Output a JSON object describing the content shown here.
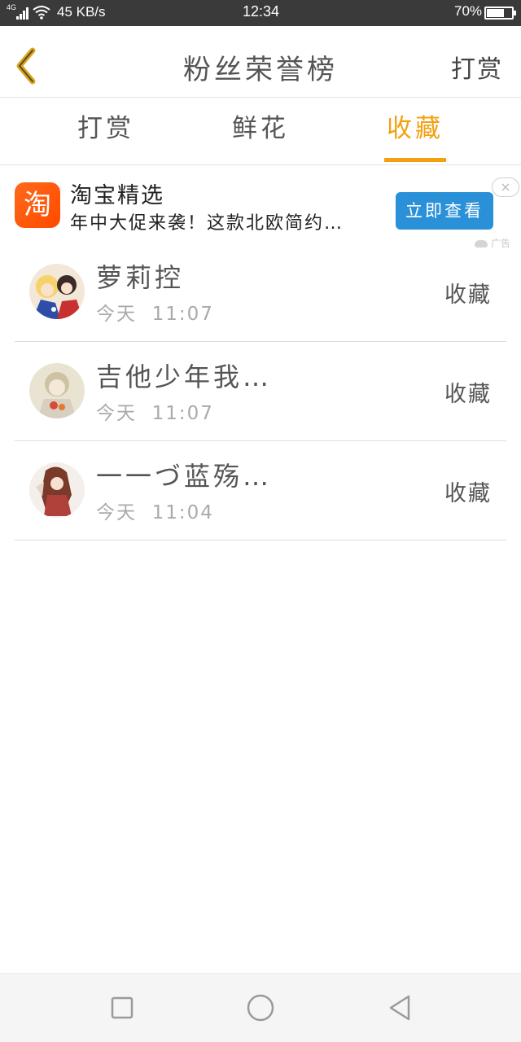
{
  "status_bar": {
    "network": "4G",
    "speed": "45 KB/s",
    "time": "12:34",
    "battery_percent": "70%",
    "battery_level": 0.7
  },
  "header": {
    "title": "粉丝荣誉榜",
    "right_action": "打赏"
  },
  "tabs": [
    {
      "label": "打赏",
      "active": false
    },
    {
      "label": "鲜花",
      "active": false
    },
    {
      "label": "收藏",
      "active": true
    }
  ],
  "ad": {
    "logo_char": "淘",
    "title": "淘宝精选",
    "description": "年中大促来袭！这款北欧简约…",
    "button_label": "立即查看",
    "close_glyph": "×",
    "tag": "广告"
  },
  "fans": [
    {
      "name": "萝莉控",
      "date": "今天",
      "time": "11:07",
      "action": "收藏"
    },
    {
      "name": "吉他少年我…",
      "date": "今天",
      "time": "11:07",
      "action": "收藏"
    },
    {
      "name": "一一づ蓝殇…",
      "date": "今天",
      "time": "11:04",
      "action": "收藏"
    }
  ],
  "colors": {
    "accent": "#f3a010",
    "ad_button": "#2a90d8",
    "ad_logo": "#ff5a00",
    "status_bar": "#3a3a3a"
  }
}
